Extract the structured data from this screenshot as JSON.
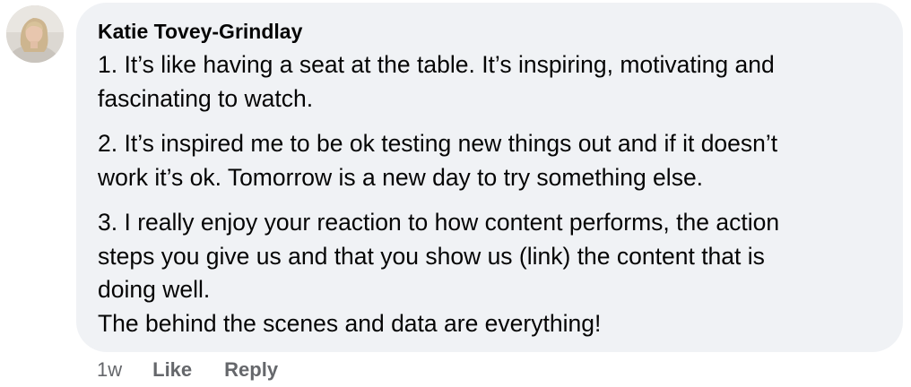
{
  "comment": {
    "avatar_icon": "user-avatar-photo",
    "author": "Katie Tovey-Grindlay",
    "paragraphs": [
      {
        "lines": [
          "1. It’s like having a seat at the table. It’s inspiring, motivating and",
          "fascinating to watch."
        ]
      },
      {
        "lines": [
          "2. It’s inspired me to be ok testing new things out and if it doesn’t",
          "work it’s ok. Tomorrow is a new day to try something else."
        ]
      },
      {
        "lines": [
          "3. I really enjoy your reaction to how content performs, the action",
          "steps you give us and that you show us (link) the content that is",
          "doing well.",
          "The behind the scenes and data are everything!"
        ]
      }
    ],
    "timestamp": "1w",
    "like_label": "Like",
    "reply_label": "Reply",
    "bubble_color": "#f0f2f5",
    "text_color": "#050505",
    "meta_color": "#65676b"
  }
}
